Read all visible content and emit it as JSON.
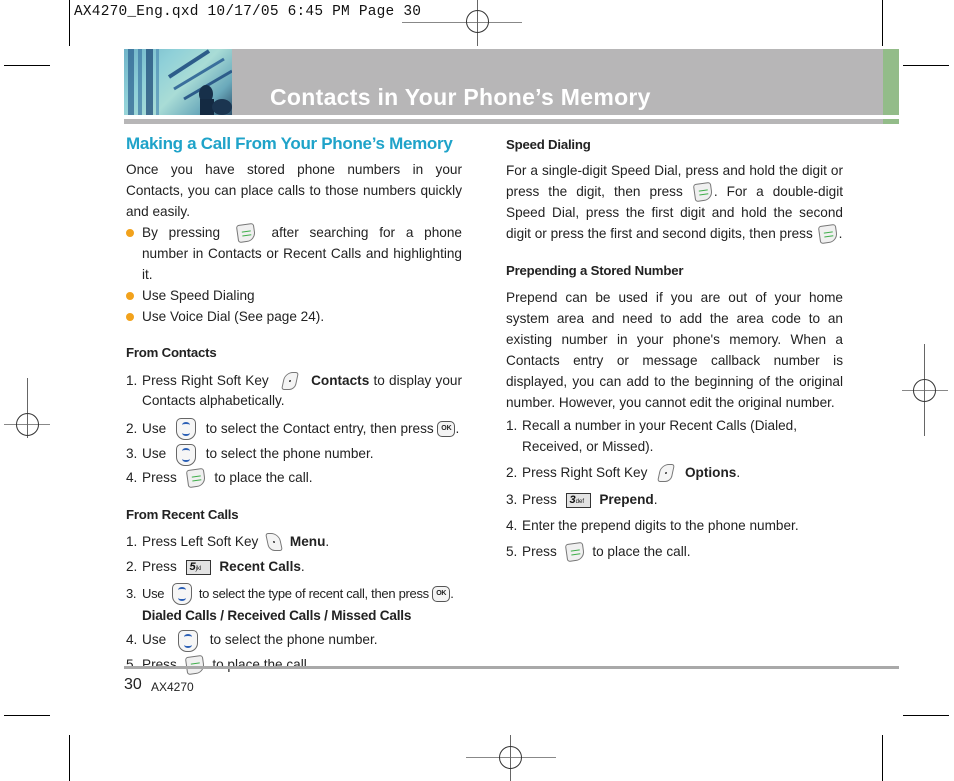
{
  "slug": "AX4270_Eng.qxd  10/17/05  6:45 PM  Page 30",
  "header": {
    "title": "Contacts in Your Phone’s Memory",
    "colors": {
      "bar": "#b7b6b7",
      "accent": "#93bc89",
      "title_text": "#ffffff"
    }
  },
  "left": {
    "section_title": "Making a Call From Your Phone’s Memory",
    "intro": "Once you have stored phone numbers in your Contacts, you can place calls to those numbers quickly and easily.",
    "bullets": [
      {
        "pre": "By pressing",
        "icon": "send-key-icon",
        "post": "after searching for a phone number in Contacts or Recent Calls and highlighting it."
      },
      {
        "text": "Use Speed Dialing"
      },
      {
        "text": "Use Voice Dial (See page 24)."
      }
    ],
    "from_contacts": {
      "heading": "From Contacts",
      "steps": [
        {
          "num": "1.",
          "pre": "Press Right Soft Key",
          "icon": "right-soft-key-icon",
          "bold": "Contacts",
          "post": "to display your Contacts alphabetically."
        },
        {
          "num": "2.",
          "pre": "Use",
          "icon": "nav-key-icon",
          "mid": "to select the Contact entry, then press",
          "icon2": "ok-key-icon",
          "post": "."
        },
        {
          "num": "3.",
          "pre": "Use",
          "icon": "nav-key-icon",
          "post": "to select the phone number."
        },
        {
          "num": "4.",
          "pre": "Press",
          "icon": "send-key-icon",
          "post": "to place the call."
        }
      ]
    },
    "from_recent": {
      "heading": "From Recent Calls",
      "steps": [
        {
          "num": "1.",
          "pre": "Press Left Soft Key",
          "icon": "left-soft-key-icon",
          "bold": "Menu",
          "post": "."
        },
        {
          "num": "2.",
          "pre": "Press",
          "icon": "key-5-icon",
          "key_digit": "5",
          "key_letters": "jkl",
          "bold": "Recent Calls",
          "post": "."
        },
        {
          "num": "3.",
          "pre": "Use",
          "icon": "nav-key-icon",
          "mid": "to select the type of recent call, then press",
          "icon2": "ok-key-icon",
          "post": ".",
          "sub_bold": "Dialed Calls / Received Calls / Missed Calls"
        },
        {
          "num": "4.",
          "pre": "Use",
          "icon": "nav-key-icon",
          "post": "to select the phone number."
        },
        {
          "num": "5.",
          "pre": "Press",
          "icon": "send-key-icon",
          "post": "to place the call."
        }
      ]
    }
  },
  "right": {
    "speed": {
      "heading": "Speed Dialing",
      "p1": "For a single-digit Speed Dial, press and hold the digit or press the digit, then press",
      "p2": ". For a double-digit Speed Dial, press the first digit and hold the second digit or press the first and second digits, then press",
      "p3": "."
    },
    "prepend": {
      "heading": "Prepending a Stored Number",
      "intro": "Prepend can be used if you are out of your home system area and need to add the area code to an existing number in your phone's memory. When a Contacts entry or message callback number is displayed, you can add to the beginning of the original number. However, you cannot edit the original number.",
      "steps": [
        {
          "num": "1.",
          "text": "Recall a number in your Recent Calls (Dialed, Received, or Missed)."
        },
        {
          "num": "2.",
          "pre": "Press Right Soft Key",
          "icon": "right-soft-key-icon",
          "bold": "Options",
          "post": "."
        },
        {
          "num": "3.",
          "pre": "Press",
          "icon": "key-3-icon",
          "key_digit": "3",
          "key_letters": "def",
          "bold": "Prepend",
          "post": "."
        },
        {
          "num": "4.",
          "text": "Enter the prepend digits to the phone number."
        },
        {
          "num": "5.",
          "pre": "Press",
          "icon": "send-key-icon",
          "post": "to place the call."
        }
      ]
    }
  },
  "ok_label": "OK",
  "footer": {
    "page_number": "30",
    "model": "AX4270"
  }
}
